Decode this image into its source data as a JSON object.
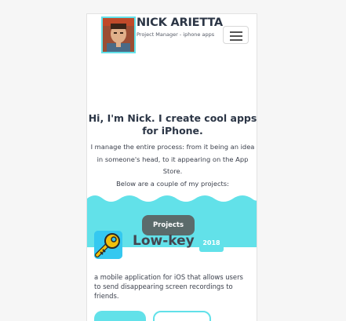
{
  "header": {
    "name": "NICK ARIETTA",
    "subtitle": "Project Manager - iphone apps",
    "menu_icon": "hamburger-icon",
    "avatar_icon": "avatar-photo"
  },
  "hero": {
    "heading": "Hi, I'm Nick. I create cool apps for iPhone.",
    "intro": "I manage the entire process: from it being an idea in someone's head, to it appearing on the App Store.",
    "intro_more": "Below are a couple of my projects:",
    "button_label": "Projects"
  },
  "project": {
    "name": "Low-key",
    "year": "2018",
    "icon": "key-icon",
    "description": "a mobile application for iOS that allows users to send disappearing screen recordings to friends."
  },
  "colors": {
    "accent": "#62e1e9",
    "button_dark": "#5b6b6b",
    "heading": "#2c3646",
    "icon_bg": "#35c8f0",
    "key": "#f2c00c"
  }
}
